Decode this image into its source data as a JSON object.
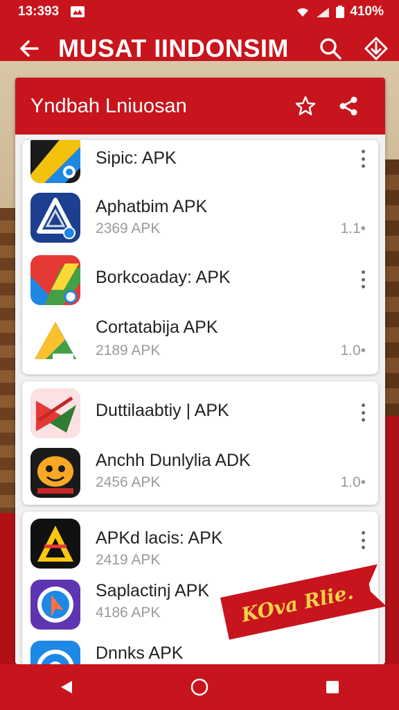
{
  "status": {
    "time": "13:393",
    "battery": "410%"
  },
  "appbar": {
    "title": "MUSAT IINDONSIM",
    "back_icon": "arrow-left-icon",
    "search_icon": "search-icon",
    "download_icon": "download-icon"
  },
  "card": {
    "title": "Yndbah Lniuosan",
    "star_icon": "star-outline-icon",
    "share_icon": "share-icon"
  },
  "groups": [
    {
      "items": [
        {
          "name": "Sipic: APK",
          "size": "",
          "version": ""
        },
        {
          "name": "Aphatbim APK",
          "size": "2369 APK",
          "version": "1.1•"
        },
        {
          "name": "Borkcoaday: APK",
          "size": "",
          "version": ""
        },
        {
          "name": "Cortatabija APK",
          "size": "2189 APK",
          "version": "1.0•"
        }
      ]
    },
    {
      "items": [
        {
          "name": "Duttilaabtiy | APK",
          "size": "",
          "version": ""
        },
        {
          "name": "Anchh Dunlylia ADK",
          "size": "2456 APK",
          "version": "1.0•"
        }
      ]
    },
    {
      "items": [
        {
          "name": "APKd lacis: APK",
          "size": "2419 APK",
          "version": ""
        },
        {
          "name": "Saplactinj APK",
          "size": "4186 APK",
          "version": ""
        },
        {
          "name": "Dnnks APK",
          "size": "",
          "version": ""
        }
      ]
    }
  ],
  "ribbon": {
    "text": "KOva Rlie."
  },
  "colors": {
    "accent": "#c8141c",
    "ribbon_text": "#f6d24a"
  }
}
